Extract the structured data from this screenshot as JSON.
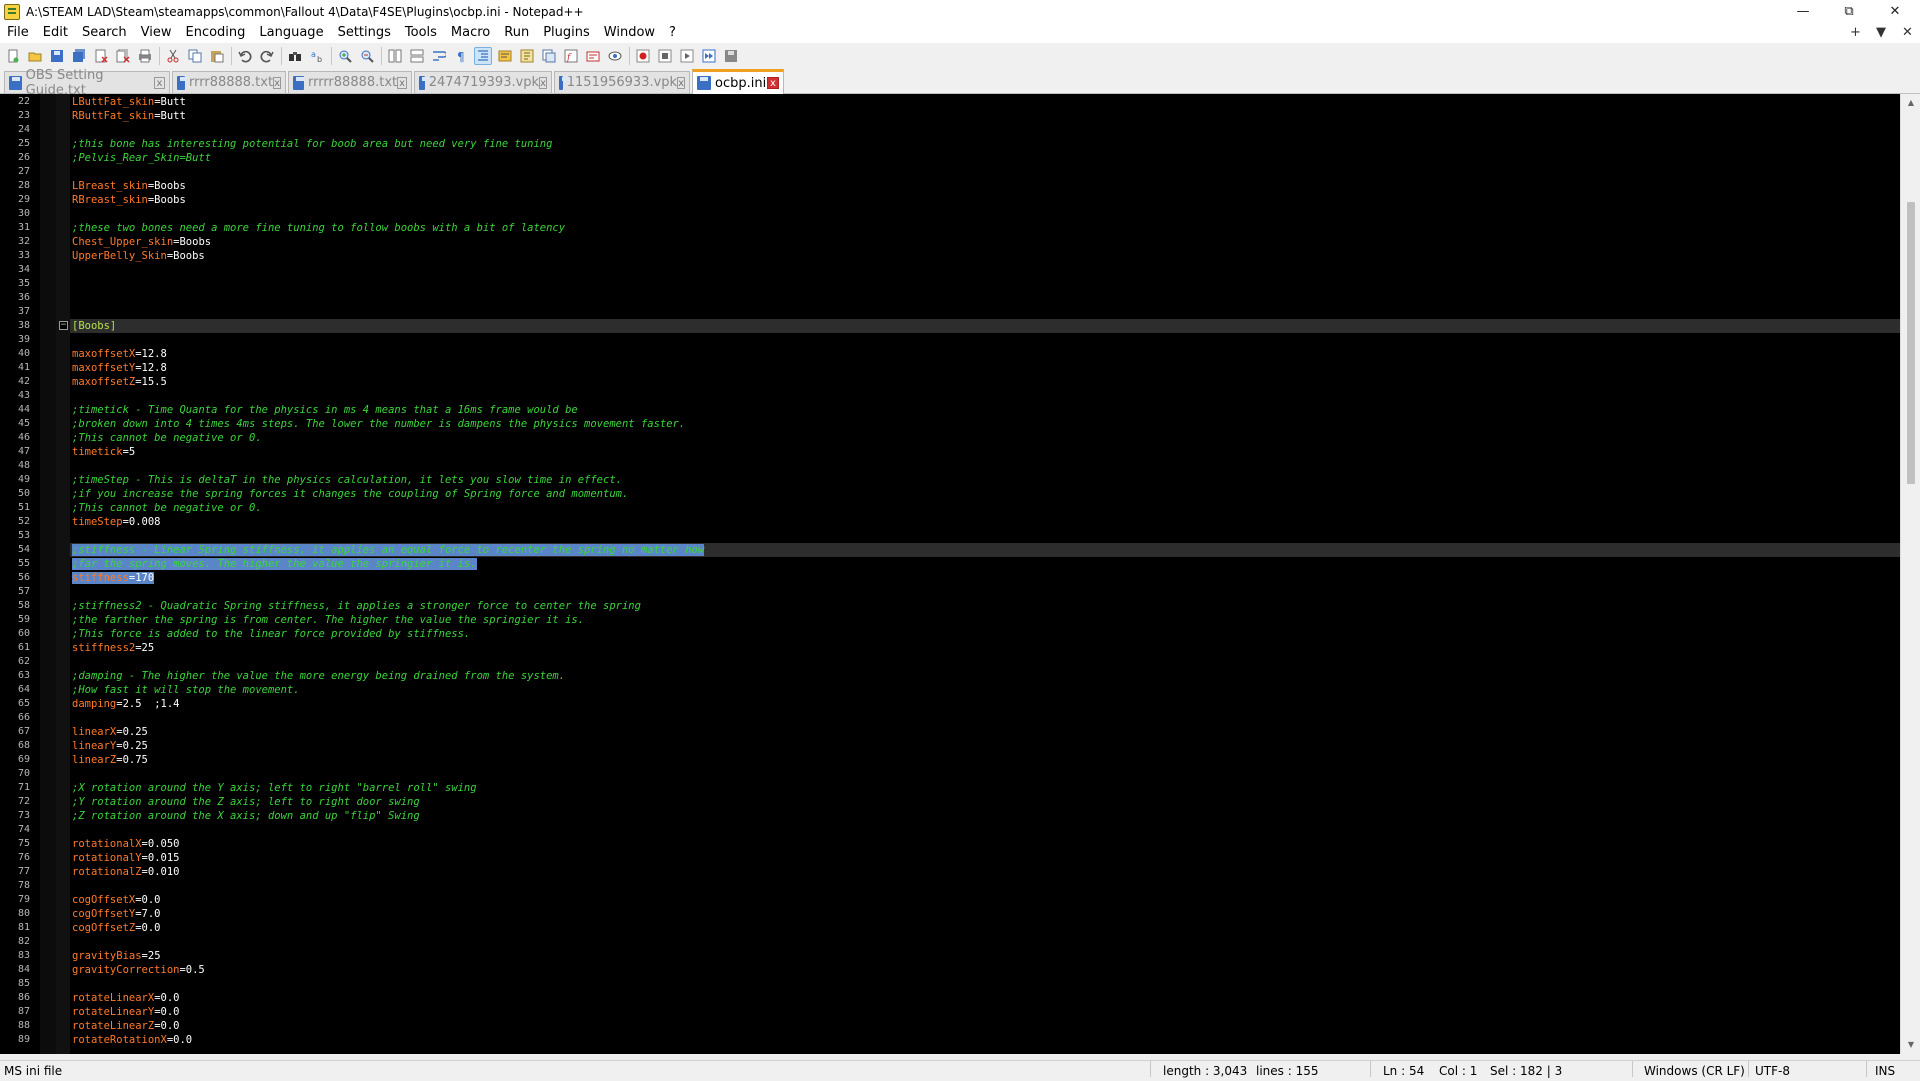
{
  "window": {
    "title": "A:\\STEAM LAD\\Steam\\steamapps\\common\\Fallout 4\\Data\\F4SE\\Plugins\\ocbp.ini - Notepad++",
    "minimize": "—",
    "maximize": "⧉",
    "close": "✕"
  },
  "menu": {
    "items": [
      "File",
      "Edit",
      "Search",
      "View",
      "Encoding",
      "Language",
      "Settings",
      "Tools",
      "Macro",
      "Run",
      "Plugins",
      "Window",
      "?"
    ],
    "right_plus": "+",
    "right_dropdown": "▼",
    "right_close": "✕"
  },
  "tabs": [
    {
      "label": "OBS Setting Guide.txt",
      "active": false
    },
    {
      "label": "rrrr88888.txt",
      "active": false
    },
    {
      "label": "rrrrr88888.txt",
      "active": false
    },
    {
      "label": "2474719393.vpk",
      "active": false
    },
    {
      "label": "1151956933.vpk",
      "active": false
    },
    {
      "label": "ocbp.ini",
      "active": true
    }
  ],
  "editor": {
    "fold_marker": "−",
    "lines": [
      {
        "n": "22",
        "parts": [
          [
            "k",
            "LButtFat_skin"
          ],
          [
            "v",
            "=Butt"
          ]
        ]
      },
      {
        "n": "23",
        "parts": [
          [
            "k",
            "RButtFat_skin"
          ],
          [
            "v",
            "=Butt"
          ]
        ]
      },
      {
        "n": "24",
        "parts": []
      },
      {
        "n": "25",
        "parts": [
          [
            "c",
            ";this bone has interesting potential for boob area but need very fine tuning"
          ]
        ]
      },
      {
        "n": "26",
        "parts": [
          [
            "c",
            ";Pelvis_Rear_Skin=Butt"
          ]
        ]
      },
      {
        "n": "27",
        "parts": []
      },
      {
        "n": "28",
        "parts": [
          [
            "k",
            "LBreast_skin"
          ],
          [
            "v",
            "=Boobs"
          ]
        ]
      },
      {
        "n": "29",
        "parts": [
          [
            "k",
            "RBreast_skin"
          ],
          [
            "v",
            "=Boobs"
          ]
        ]
      },
      {
        "n": "30",
        "parts": []
      },
      {
        "n": "31",
        "parts": [
          [
            "c",
            ";these two bones need a more fine tuning to follow boobs with a bit of latency"
          ]
        ]
      },
      {
        "n": "32",
        "parts": [
          [
            "k",
            "Chest_Upper_skin"
          ],
          [
            "v",
            "=Boobs"
          ]
        ]
      },
      {
        "n": "33",
        "parts": [
          [
            "k",
            "UpperBelly_Skin"
          ],
          [
            "v",
            "=Boobs"
          ]
        ]
      },
      {
        "n": "34",
        "parts": []
      },
      {
        "n": "35",
        "parts": []
      },
      {
        "n": "36",
        "parts": []
      },
      {
        "n": "37",
        "parts": []
      },
      {
        "n": "38",
        "parts": [
          [
            "s",
            "[Boobs]"
          ]
        ],
        "fold": true,
        "current": true
      },
      {
        "n": "39",
        "parts": []
      },
      {
        "n": "40",
        "parts": [
          [
            "k",
            "maxoffsetX"
          ],
          [
            "v",
            "=12.8"
          ]
        ]
      },
      {
        "n": "41",
        "parts": [
          [
            "k",
            "maxoffsetY"
          ],
          [
            "v",
            "=12.8"
          ]
        ]
      },
      {
        "n": "42",
        "parts": [
          [
            "k",
            "maxoffsetZ"
          ],
          [
            "v",
            "=15.5"
          ]
        ]
      },
      {
        "n": "43",
        "parts": []
      },
      {
        "n": "44",
        "parts": [
          [
            "c",
            ";timetick - Time Quanta for the physics in ms 4 means that a 16ms frame would be"
          ]
        ]
      },
      {
        "n": "45",
        "parts": [
          [
            "c",
            ";broken down into 4 times 4ms steps. The lower the number is dampens the physics movement faster."
          ]
        ]
      },
      {
        "n": "46",
        "parts": [
          [
            "c",
            ";This cannot be negative or 0."
          ]
        ]
      },
      {
        "n": "47",
        "parts": [
          [
            "k",
            "timetick"
          ],
          [
            "v",
            "=5"
          ]
        ]
      },
      {
        "n": "48",
        "parts": []
      },
      {
        "n": "49",
        "parts": [
          [
            "c",
            ";timeStep - This is deltaT in the physics calculation, it lets you slow time in effect."
          ]
        ]
      },
      {
        "n": "50",
        "parts": [
          [
            "c",
            ";if you increase the spring forces it changes the coupling of Spring force and momentum."
          ]
        ]
      },
      {
        "n": "51",
        "parts": [
          [
            "c",
            ";This cannot be negative or 0."
          ]
        ]
      },
      {
        "n": "52",
        "parts": [
          [
            "k",
            "timeStep"
          ],
          [
            "v",
            "=0.008"
          ]
        ]
      },
      {
        "n": "53",
        "parts": []
      },
      {
        "n": "54",
        "parts": [
          [
            "c",
            ";stiffness - Linear Spring stiffness, it applies an equal force to recenter the spring no matter how"
          ]
        ],
        "sel": true,
        "current": true
      },
      {
        "n": "55",
        "parts": [
          [
            "c",
            ";far the spring moves. The higher the value the springier it is."
          ]
        ],
        "sel": true
      },
      {
        "n": "56",
        "parts": [
          [
            "k",
            "stiffness"
          ],
          [
            "v",
            "=170"
          ]
        ],
        "sel": true
      },
      {
        "n": "57",
        "parts": []
      },
      {
        "n": "58",
        "parts": [
          [
            "c",
            ";stiffness2 - Quadratic Spring stiffness, it applies a stronger force to center the spring"
          ]
        ]
      },
      {
        "n": "59",
        "parts": [
          [
            "c",
            ";the farther the spring is from center. The higher the value the springier it is."
          ]
        ]
      },
      {
        "n": "60",
        "parts": [
          [
            "c",
            ";This force is added to the linear force provided by stiffness."
          ]
        ]
      },
      {
        "n": "61",
        "parts": [
          [
            "k",
            "stiffness2"
          ],
          [
            "v",
            "=25"
          ]
        ]
      },
      {
        "n": "62",
        "parts": []
      },
      {
        "n": "63",
        "parts": [
          [
            "c",
            ";damping - The higher the value the more energy being drained from the system."
          ]
        ]
      },
      {
        "n": "64",
        "parts": [
          [
            "c",
            ";How fast it will stop the movement."
          ]
        ]
      },
      {
        "n": "65",
        "parts": [
          [
            "k",
            "damping"
          ],
          [
            "v",
            "=2.5  ;1.4"
          ]
        ]
      },
      {
        "n": "66",
        "parts": []
      },
      {
        "n": "67",
        "parts": [
          [
            "k",
            "linearX"
          ],
          [
            "v",
            "=0.25"
          ]
        ]
      },
      {
        "n": "68",
        "parts": [
          [
            "k",
            "linearY"
          ],
          [
            "v",
            "=0.25"
          ]
        ]
      },
      {
        "n": "69",
        "parts": [
          [
            "k",
            "linearZ"
          ],
          [
            "v",
            "=0.75"
          ]
        ]
      },
      {
        "n": "70",
        "parts": []
      },
      {
        "n": "71",
        "parts": [
          [
            "c",
            ";X rotation around the Y axis; left to right \"barrel roll\" swing"
          ]
        ]
      },
      {
        "n": "72",
        "parts": [
          [
            "c",
            ";Y rotation around the Z axis; left to right door swing"
          ]
        ]
      },
      {
        "n": "73",
        "parts": [
          [
            "c",
            ";Z rotation around the X axis; down and up \"flip\" Swing"
          ]
        ]
      },
      {
        "n": "74",
        "parts": []
      },
      {
        "n": "75",
        "parts": [
          [
            "k",
            "rotationalX"
          ],
          [
            "v",
            "=0.050"
          ]
        ]
      },
      {
        "n": "76",
        "parts": [
          [
            "k",
            "rotationalY"
          ],
          [
            "v",
            "=0.015"
          ]
        ]
      },
      {
        "n": "77",
        "parts": [
          [
            "k",
            "rotationalZ"
          ],
          [
            "v",
            "=0.010"
          ]
        ]
      },
      {
        "n": "78",
        "parts": []
      },
      {
        "n": "79",
        "parts": [
          [
            "k",
            "cogOffsetX"
          ],
          [
            "v",
            "=0.0"
          ]
        ]
      },
      {
        "n": "80",
        "parts": [
          [
            "k",
            "cogOffsetY"
          ],
          [
            "v",
            "=7.0"
          ]
        ]
      },
      {
        "n": "81",
        "parts": [
          [
            "k",
            "cogOffsetZ"
          ],
          [
            "v",
            "=0.0"
          ]
        ]
      },
      {
        "n": "82",
        "parts": []
      },
      {
        "n": "83",
        "parts": [
          [
            "k",
            "gravityBias"
          ],
          [
            "v",
            "=25"
          ]
        ]
      },
      {
        "n": "84",
        "parts": [
          [
            "k",
            "gravityCorrection"
          ],
          [
            "v",
            "=0.5"
          ]
        ]
      },
      {
        "n": "85",
        "parts": []
      },
      {
        "n": "86",
        "parts": [
          [
            "k",
            "rotateLinearX"
          ],
          [
            "v",
            "=0.0"
          ]
        ]
      },
      {
        "n": "87",
        "parts": [
          [
            "k",
            "rotateLinearY"
          ],
          [
            "v",
            "=0.0"
          ]
        ]
      },
      {
        "n": "88",
        "parts": [
          [
            "k",
            "rotateLinearZ"
          ],
          [
            "v",
            "=0.0"
          ]
        ]
      },
      {
        "n": "89",
        "parts": [
          [
            "k",
            "rotateRotationX"
          ],
          [
            "v",
            "=0.0"
          ]
        ]
      }
    ]
  },
  "status": {
    "file_type": "MS ini file",
    "length": "length : 3,043",
    "lines": "lines : 155",
    "ln": "Ln : 54",
    "col": "Col : 1",
    "sel": "Sel : 182 | 3",
    "eol": "Windows (CR LF)",
    "encoding": "UTF-8",
    "mode": "INS"
  },
  "colors": {
    "comment": "#3cd43c",
    "key": "#ff7a2a",
    "value": "#ffffff",
    "section": "#b6e24a",
    "selection": "#5a86c8",
    "editor_bg": "#000000",
    "active_tab_accent": "#f0a020"
  }
}
